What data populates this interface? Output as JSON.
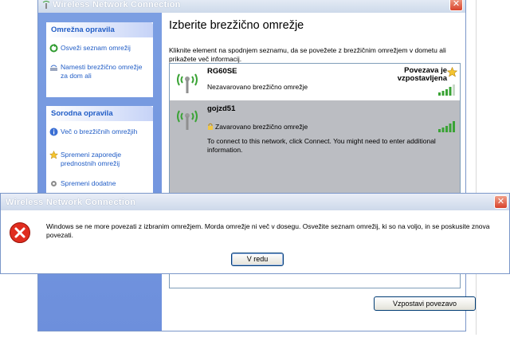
{
  "window": {
    "title": "Wireless Network Connection",
    "close_glyph": "✕"
  },
  "tasks": {
    "network_tasks": {
      "header": "Omrežna opravila",
      "items": [
        {
          "label": "Osveži seznam omrežij",
          "icon": "refresh-icon"
        },
        {
          "label": "Namesti brezžično omrežje za dom ali",
          "icon": "setup-icon"
        }
      ]
    },
    "related_tasks": {
      "header": "Sorodna opravila",
      "items": [
        {
          "label": "Več o brezžičnih omrežjih",
          "icon": "info-icon"
        },
        {
          "label": "Spremeni zaporedje prednostnih omrežij",
          "icon": "star-icon"
        },
        {
          "label": "Spremeni dodatne",
          "icon": "settings-icon"
        }
      ]
    }
  },
  "main": {
    "heading": "Izberite brezžično omrežje",
    "instructions": "Kliknite element na spodnjem seznamu, da se povežete z brezžičnim omrežjem v dometu ali prikažete več informacij.",
    "networks": [
      {
        "ssid": "RG60SE",
        "status": "Nezavarovano brezžično omrežje",
        "connection": "Povezava je vzpostavljena",
        "signal_bars": 4
      },
      {
        "ssid": "gojzd51",
        "status": "Zavarovano brezžično omrežje",
        "detail": "To connect to this network, click Connect. You might need to enter additional information.",
        "signal_bars": 5
      }
    ],
    "connect_button": "Vzpostavi povezavo"
  },
  "error_dialog": {
    "title": "Wireless Network Connection",
    "close_glyph": "✕",
    "message": "Windows se ne more povezati z izbranim omrežjem. Morda omrežje ni več v dosegu. Osvežite seznam omrežij, ki so na voljo, in se poskusite znova povezati.",
    "ok_button": "V redu"
  },
  "colors": {
    "xp_link_blue": "#215dc6",
    "task_pane_blue": "#6d8fdc",
    "selected_row": "#bbbdc2",
    "signal_green": "#3aa335",
    "error_red": "#e02d1f"
  }
}
